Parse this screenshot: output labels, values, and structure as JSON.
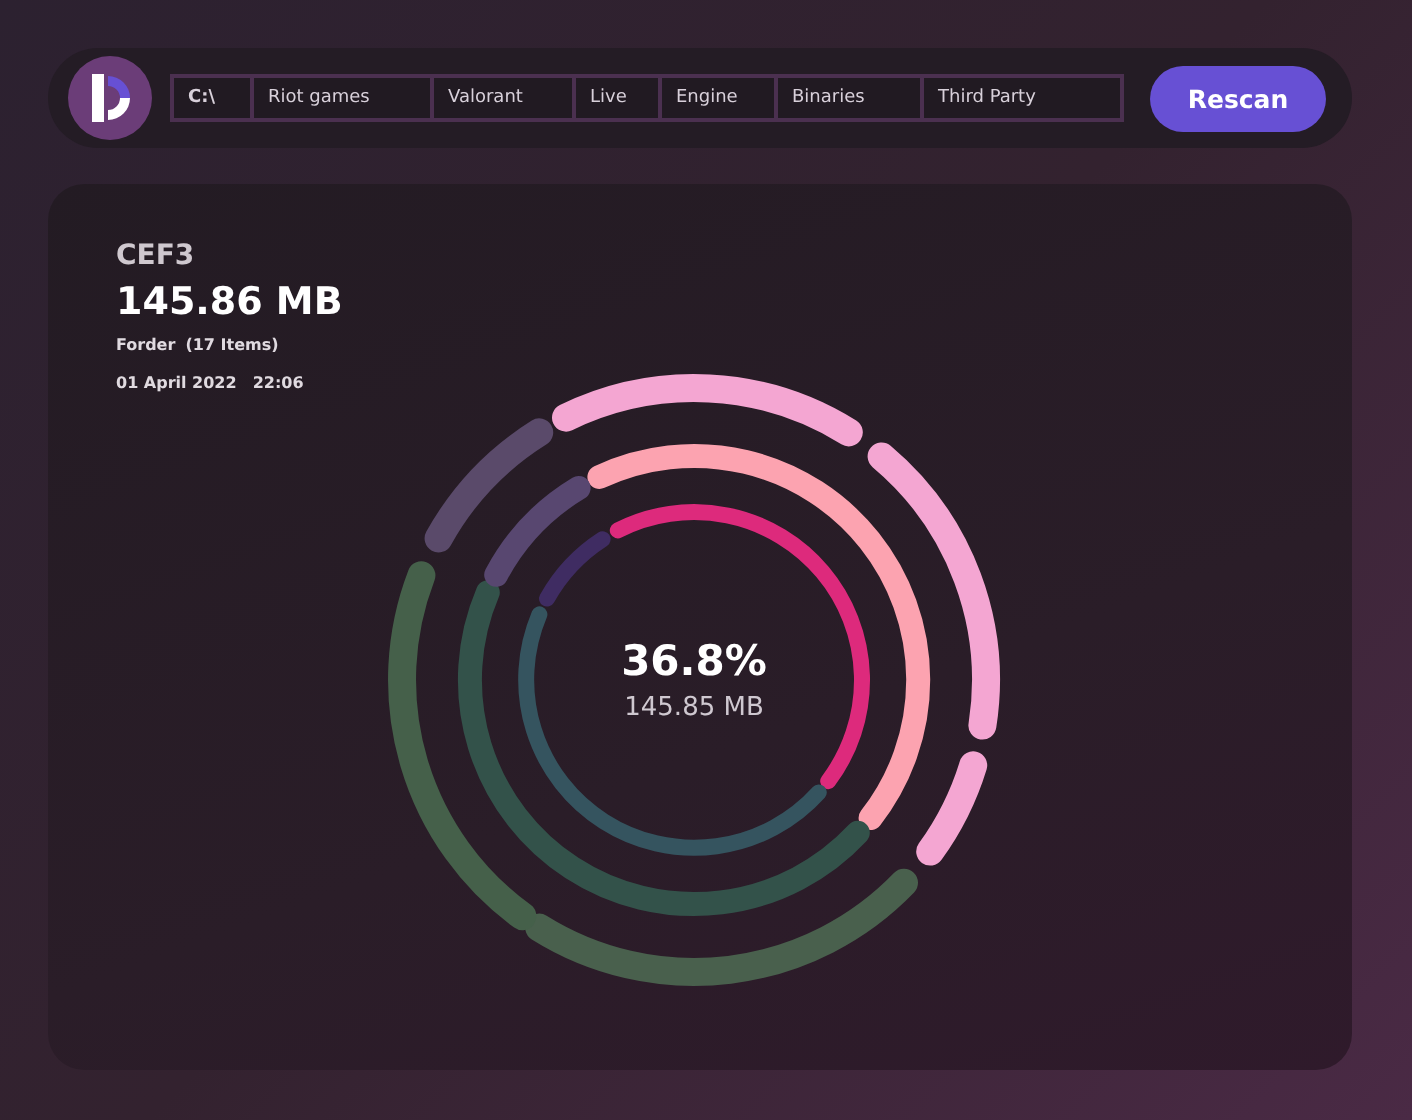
{
  "toolbar": {
    "path": [
      {
        "label": "C:\\",
        "kind": "drive"
      },
      {
        "label": "Riot games",
        "kind": "folder"
      },
      {
        "label": "Valorant",
        "kind": "folder"
      },
      {
        "label": "Live",
        "kind": "folder"
      },
      {
        "label": "Engine",
        "kind": "folder"
      },
      {
        "label": "Binaries",
        "kind": "folder"
      },
      {
        "label": "Third Party",
        "kind": "folder"
      }
    ],
    "button": "Rescan"
  },
  "details": {
    "name": "CEF3",
    "size": "145.86 MB",
    "type": "Forder",
    "count": "(17 Items)",
    "date": "01 April 2022",
    "time": "22:06"
  },
  "center": {
    "percent": "36.8%",
    "size": "145.85 MB"
  }
}
